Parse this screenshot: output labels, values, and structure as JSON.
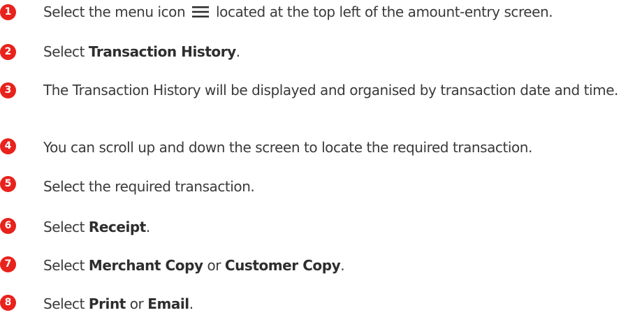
{
  "colors": {
    "badge": "#e8221c",
    "text": "#3a3a3a"
  },
  "steps": [
    {
      "number": "1",
      "before": "Select the menu icon",
      "icon": "hamburger-menu-icon",
      "after": "located at the top left of the amount-entry screen."
    },
    {
      "number": "2",
      "before": "Select ",
      "bold": "Transaction History",
      "after": "."
    },
    {
      "number": "3",
      "text": "The Transaction History will be displayed and organised by transaction date and time."
    },
    {
      "number": "4",
      "text": "You can scroll up and down the screen to locate the required transaction."
    },
    {
      "number": "5",
      "text": "Select the required transaction."
    },
    {
      "number": "6",
      "before": "Select ",
      "bold": "Receipt",
      "after": "."
    },
    {
      "number": "7",
      "before": "Select ",
      "bold": "Merchant Copy",
      "middle": " or ",
      "bold2": "Customer Copy",
      "after": "."
    },
    {
      "number": "8",
      "before": "Select ",
      "bold": "Print",
      "middle": " or ",
      "bold2": "Email",
      "after": "."
    }
  ]
}
